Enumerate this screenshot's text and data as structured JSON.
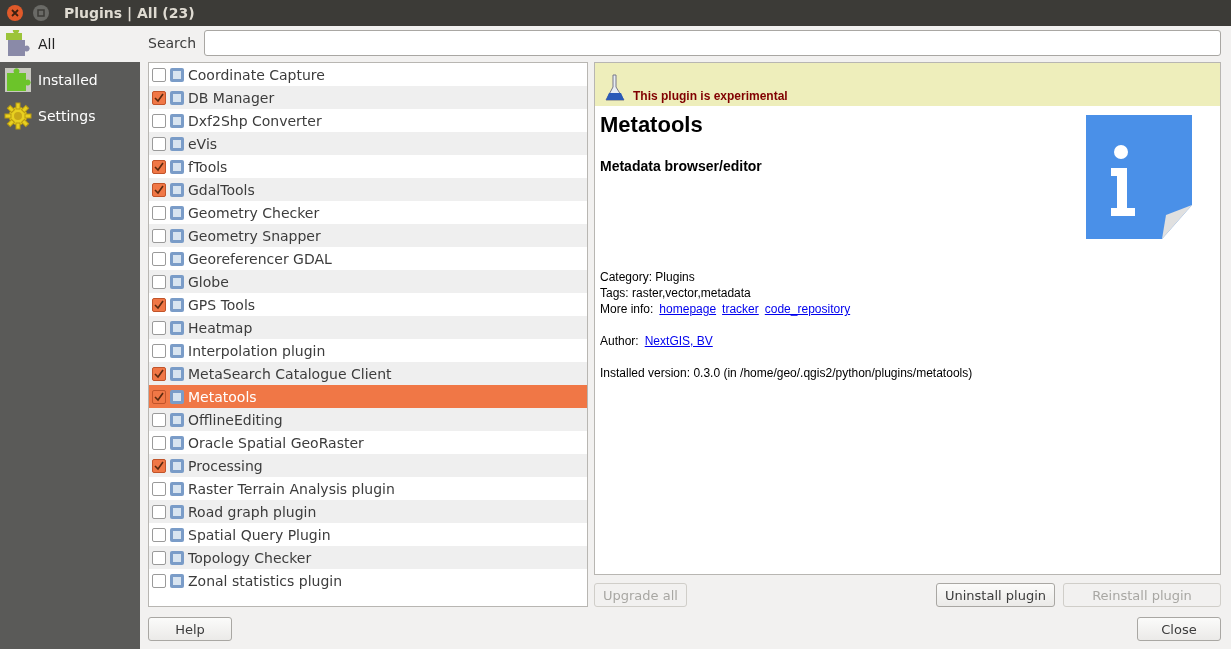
{
  "window": {
    "title": "Plugins | All (23)"
  },
  "sidebar": {
    "items": [
      {
        "label": "All",
        "selected": true,
        "kind": "all"
      },
      {
        "label": "Installed",
        "selected": false,
        "kind": "installed"
      },
      {
        "label": "Settings",
        "selected": false,
        "kind": "settings"
      }
    ]
  },
  "search": {
    "label": "Search"
  },
  "plugins": [
    {
      "name": "Coordinate Capture",
      "checked": false,
      "selected": false
    },
    {
      "name": "DB Manager",
      "checked": true,
      "selected": false
    },
    {
      "name": "Dxf2Shp Converter",
      "checked": false,
      "selected": false
    },
    {
      "name": "eVis",
      "checked": false,
      "selected": false
    },
    {
      "name": "fTools",
      "checked": true,
      "selected": false
    },
    {
      "name": "GdalTools",
      "checked": true,
      "selected": false
    },
    {
      "name": "Geometry Checker",
      "checked": false,
      "selected": false
    },
    {
      "name": "Geometry Snapper",
      "checked": false,
      "selected": false
    },
    {
      "name": "Georeferencer GDAL",
      "checked": false,
      "selected": false
    },
    {
      "name": "Globe",
      "checked": false,
      "selected": false
    },
    {
      "name": "GPS Tools",
      "checked": true,
      "selected": false
    },
    {
      "name": "Heatmap",
      "checked": false,
      "selected": false
    },
    {
      "name": "Interpolation plugin",
      "checked": false,
      "selected": false
    },
    {
      "name": "MetaSearch Catalogue Client",
      "checked": true,
      "selected": false
    },
    {
      "name": "Metatools",
      "checked": true,
      "selected": true
    },
    {
      "name": "OfflineEditing",
      "checked": false,
      "selected": false
    },
    {
      "name": "Oracle Spatial GeoRaster",
      "checked": false,
      "selected": false
    },
    {
      "name": "Processing",
      "checked": true,
      "selected": false
    },
    {
      "name": "Raster Terrain Analysis plugin",
      "checked": false,
      "selected": false
    },
    {
      "name": "Road graph plugin",
      "checked": false,
      "selected": false
    },
    {
      "name": "Spatial Query Plugin",
      "checked": false,
      "selected": false
    },
    {
      "name": "Topology Checker",
      "checked": false,
      "selected": false
    },
    {
      "name": "Zonal statistics plugin",
      "checked": false,
      "selected": false
    }
  ],
  "details": {
    "warning": "This plugin is experimental",
    "title": "Metatools",
    "description": "Metadata browser/editor",
    "category": "Category: Plugins",
    "tags": "Tags: raster,vector,metadata",
    "more_info_label": "More info:",
    "links": [
      "homepage",
      "tracker",
      "code_repository"
    ],
    "author_label": "Author:",
    "author": "NextGIS, BV",
    "installed_version": "Installed version: 0.3.0 (in /home/geo/.qgis2/python/plugins/metatools)"
  },
  "actions": [
    {
      "label": "Upgrade all",
      "disabled": true
    },
    {
      "label": "Uninstall plugin",
      "disabled": false
    },
    {
      "label": "Reinstall plugin",
      "disabled": true
    }
  ],
  "footer": {
    "help": "Help",
    "close": "Close"
  }
}
